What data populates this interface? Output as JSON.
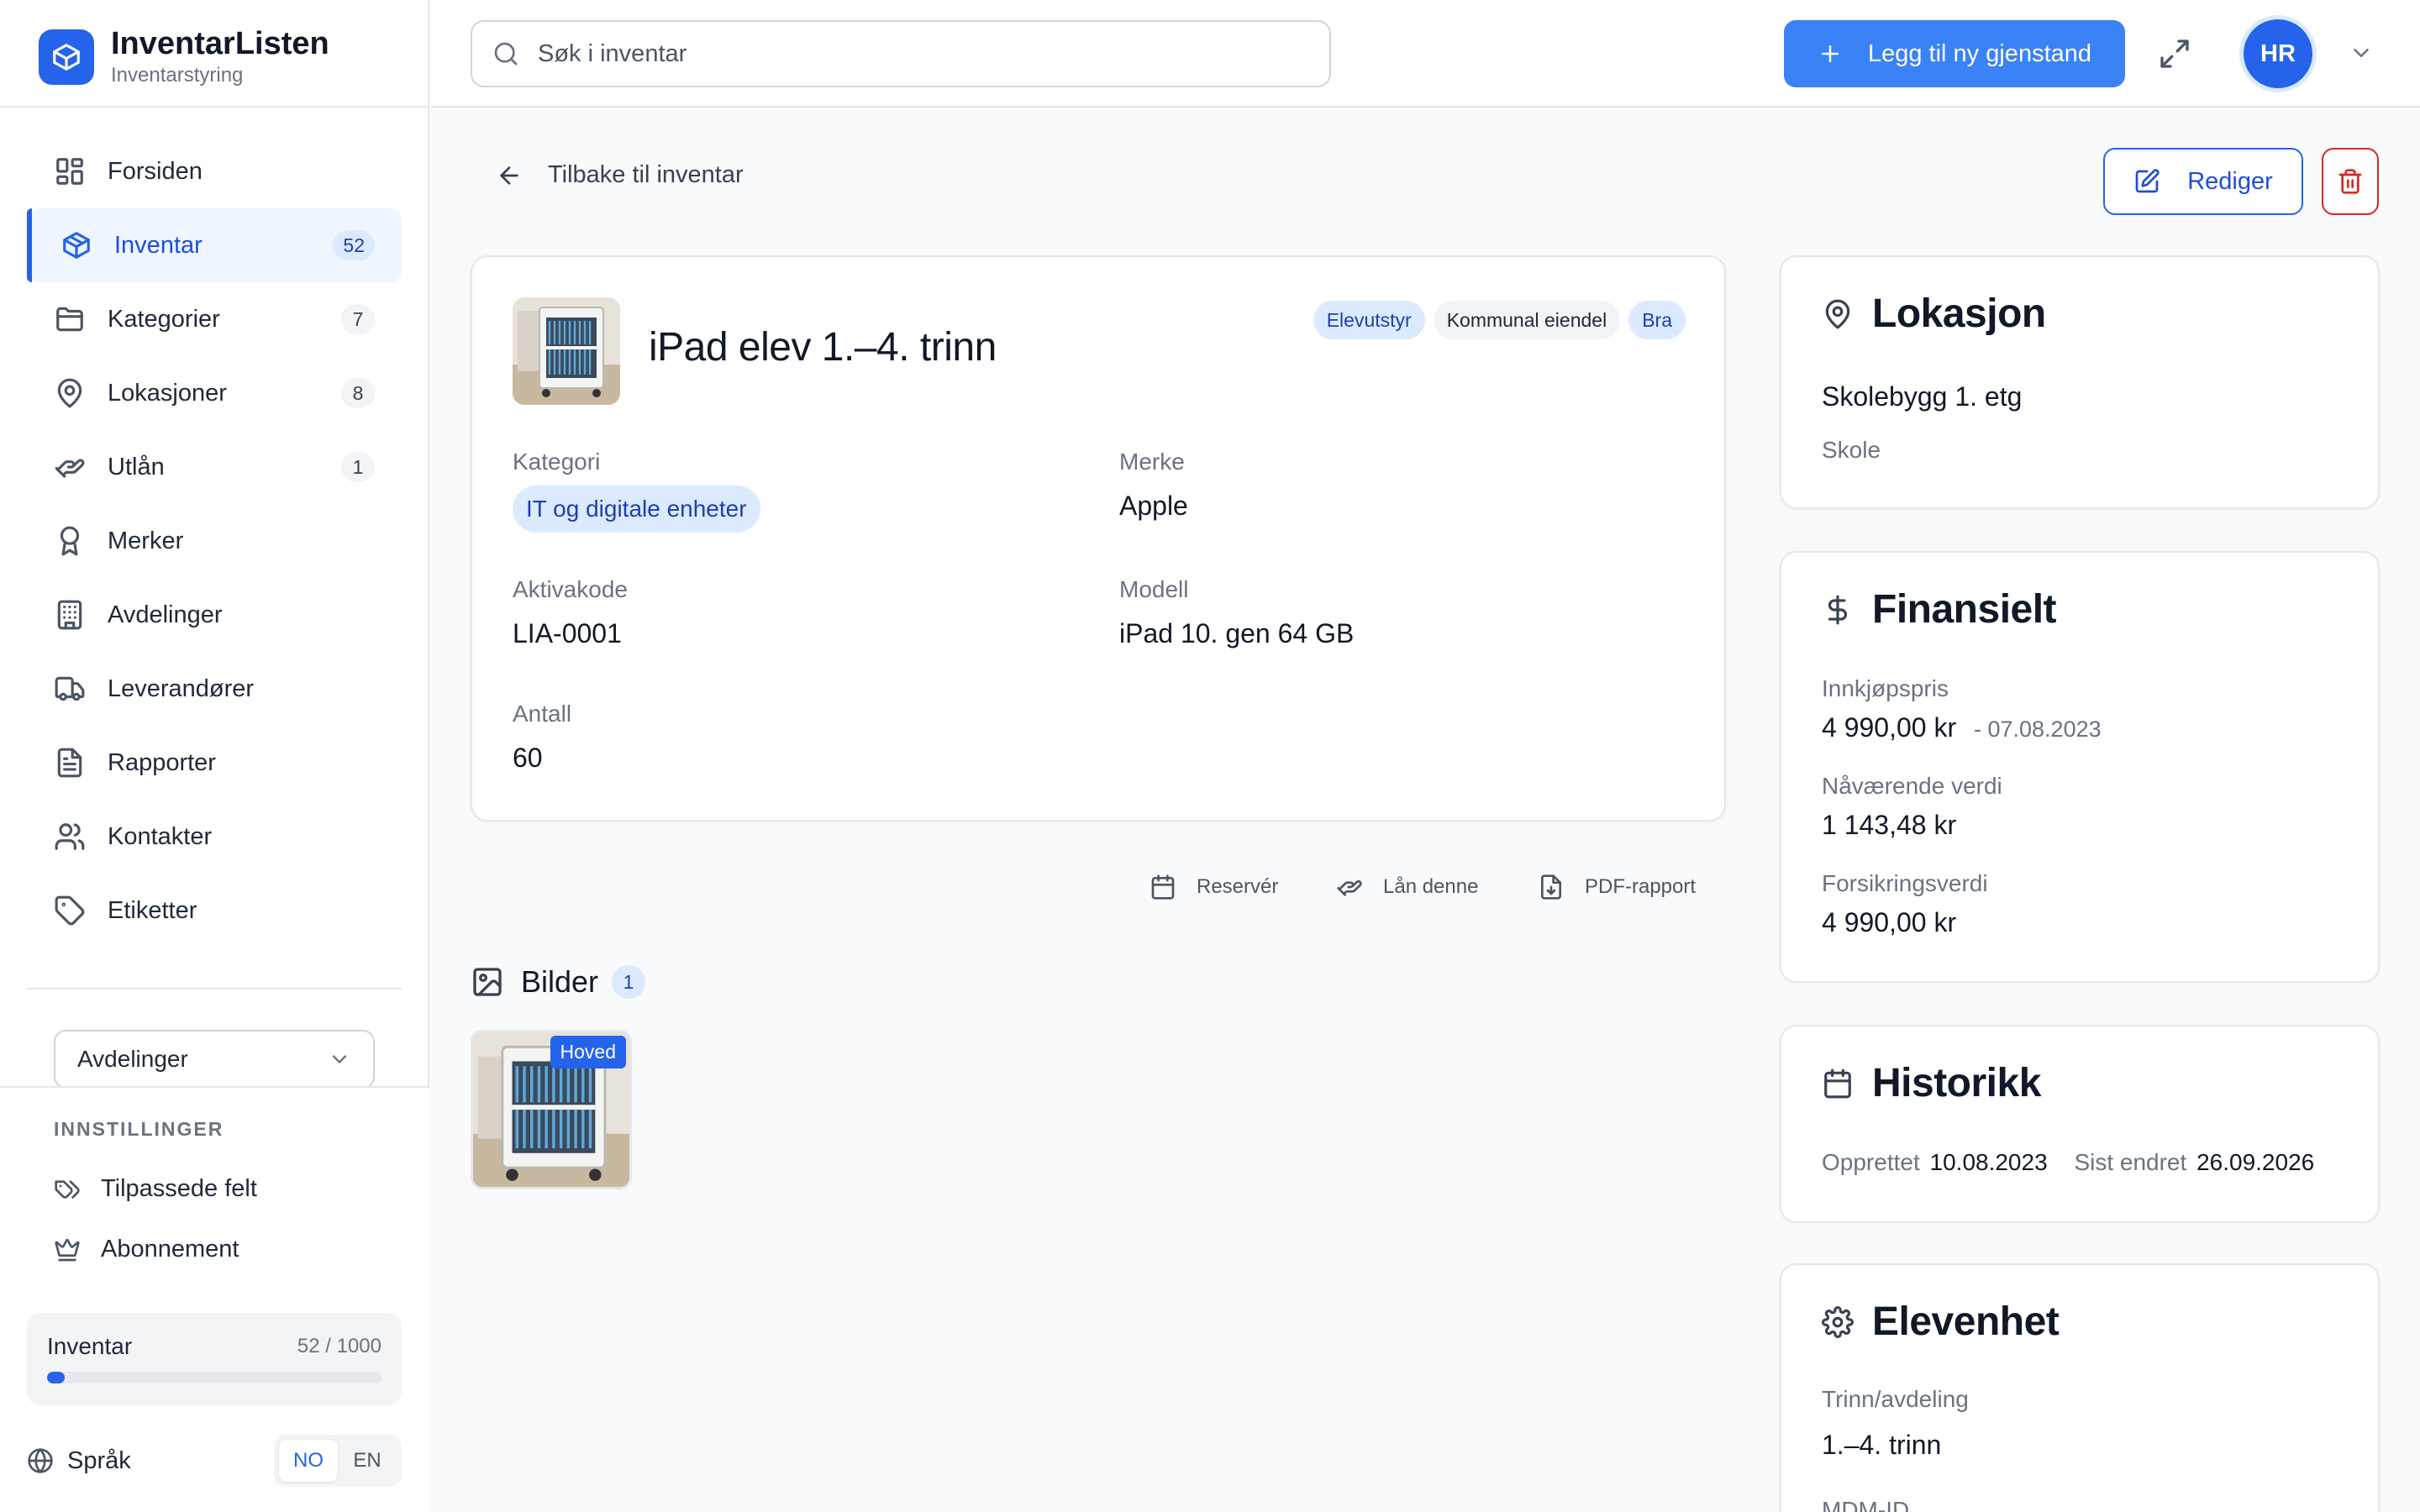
{
  "brand": {
    "title": "InventarListen",
    "subtitle": "Inventarstyring"
  },
  "nav": [
    {
      "label": "Forsiden",
      "icon": "dashboard-grid-icon"
    },
    {
      "label": "Inventar",
      "icon": "box-icon",
      "badge": "52",
      "active": true
    },
    {
      "label": "Kategorier",
      "icon": "folder-icon",
      "badge": "7"
    },
    {
      "label": "Lokasjoner",
      "icon": "map-pin-icon",
      "badge": "8"
    },
    {
      "label": "Utlån",
      "icon": "hand-icon",
      "badge": "1"
    },
    {
      "label": "Merker",
      "icon": "award-icon"
    },
    {
      "label": "Avdelinger",
      "icon": "building-icon"
    },
    {
      "label": "Leverandører",
      "icon": "truck-icon"
    },
    {
      "label": "Rapporter",
      "icon": "file-text-icon"
    },
    {
      "label": "Kontakter",
      "icon": "users-icon"
    },
    {
      "label": "Etiketter",
      "icon": "tag-icon"
    }
  ],
  "department_select": {
    "value": "Avdelinger"
  },
  "settings": {
    "heading": "INNSTILLINGER",
    "items": [
      {
        "label": "Tilpassede felt",
        "icon": "tags-icon"
      },
      {
        "label": "Abonnement",
        "icon": "crown-icon"
      }
    ]
  },
  "usage": {
    "label": "Inventar",
    "count": "52 / 1000",
    "fraction": 0.052
  },
  "language": {
    "label": "Språk",
    "options": [
      "NO",
      "EN"
    ],
    "active": "NO"
  },
  "header": {
    "search_placeholder": "Søk i inventar",
    "add_button": "Legg til ny gjenstand",
    "avatar_initials": "HR"
  },
  "page": {
    "back_label": "Tilbake til inventar",
    "edit_label": "Rediger"
  },
  "item": {
    "title": "iPad elev 1.–4. trinn",
    "tags": [
      "Elevutstyr",
      "Kommunal eiendel",
      "Bra"
    ],
    "fields": {
      "category_label": "Kategori",
      "category_value": "IT og digitale enheter",
      "brand_label": "Merke",
      "brand_value": "Apple",
      "asset_code_label": "Aktivakode",
      "asset_code_value": "LIA-0001",
      "model_label": "Modell",
      "model_value": "iPad 10. gen 64 GB",
      "quantity_label": "Antall",
      "quantity_value": "60"
    }
  },
  "actions": {
    "reserve": "Reservér",
    "loan": "Lån denne",
    "pdf": "PDF-rapport"
  },
  "images": {
    "heading": "Bilder",
    "count": "1",
    "main_badge": "Hoved"
  },
  "location": {
    "title": "Lokasjon",
    "name": "Skolebygg 1. etg",
    "sub": "Skole"
  },
  "financial": {
    "title": "Finansielt",
    "purchase_label": "Innkjøpspris",
    "purchase_value": "4 990,00 kr",
    "purchase_date": "- 07.08.2023",
    "current_label": "Nåværende verdi",
    "current_value": "1 143,48 kr",
    "insurance_label": "Forsikringsverdi",
    "insurance_value": "4 990,00 kr"
  },
  "history": {
    "title": "Historikk",
    "created_label": "Opprettet",
    "created_value": "10.08.2023",
    "modified_label": "Sist endret",
    "modified_value": "26.09.2026"
  },
  "student_unit": {
    "title": "Elevenhet",
    "grade_label": "Trinn/avdeling",
    "grade_value": "1.–4. trinn",
    "mdm_label": "MDM-ID"
  }
}
